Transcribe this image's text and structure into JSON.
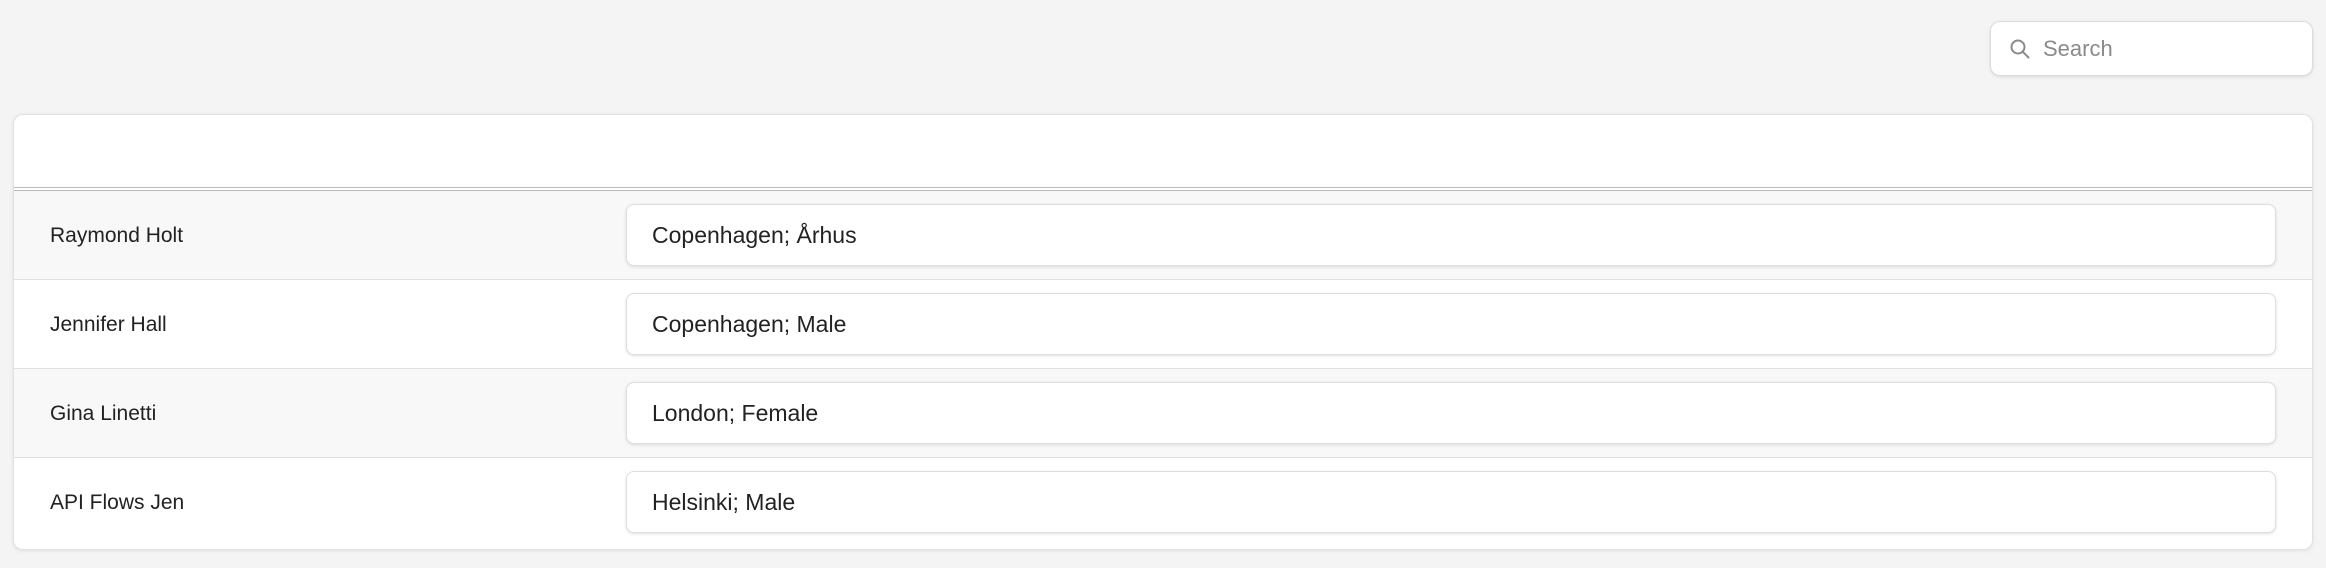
{
  "search": {
    "placeholder": "Search",
    "value": "",
    "icon": "search-icon"
  },
  "table": {
    "rows": [
      {
        "name": "Raymond Holt",
        "value": "Copenhagen; Århus"
      },
      {
        "name": "Jennifer Hall",
        "value": "Copenhagen; Male"
      },
      {
        "name": "Gina Linetti",
        "value": "London; Female"
      },
      {
        "name": "API Flows Jen",
        "value": "Helsinki; Male"
      }
    ]
  },
  "colors": {
    "page_background": "#f4f4f4",
    "panel_background": "#ffffff",
    "row_alt_background": "#f8f8f8",
    "text": "#222222",
    "placeholder_text": "#8a8a8a"
  }
}
